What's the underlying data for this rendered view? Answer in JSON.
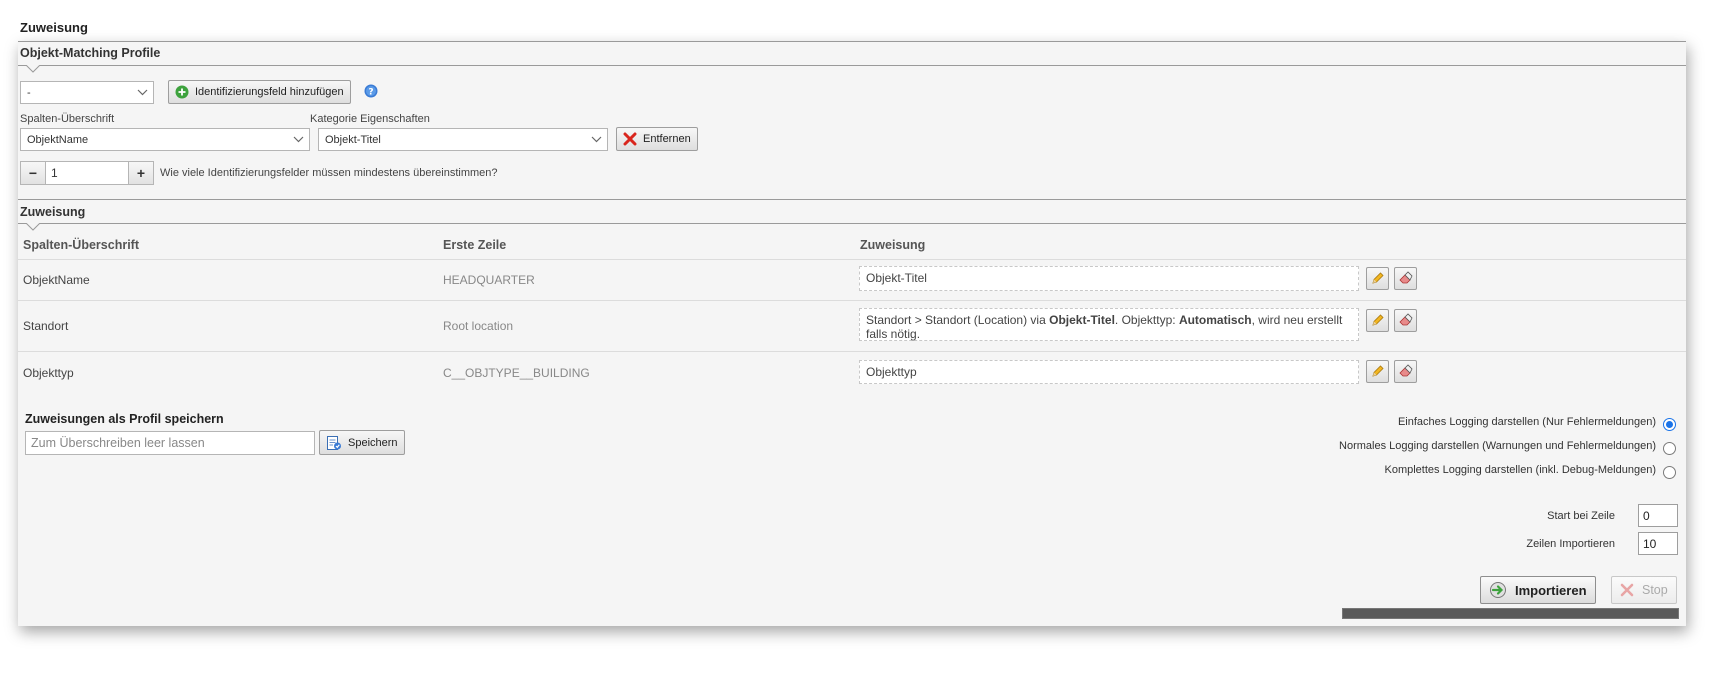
{
  "page": {
    "title": "Zuweisung"
  },
  "matching": {
    "title": "Objekt-Matching Profile",
    "profile_select": "-",
    "add_button": "Identifizierungsfeld hinzufügen",
    "help_icon": "help-icon",
    "col_header_label": "Spalten-Überschrift",
    "category_label": "Kategorie Eigenschaften",
    "col_header_value": "ObjektName",
    "category_value": "Objekt-Titel",
    "remove_button": "Entfernen",
    "min_count": "1",
    "min_count_label": "Wie viele Identifizierungsfelder müssen mindestens übereinstimmen?"
  },
  "assignment": {
    "title": "Zuweisung",
    "headers": {
      "col": "Spalten-Überschrift",
      "first_row": "Erste Zeile",
      "assign": "Zuweisung"
    },
    "rows": [
      {
        "col": "ObjektName",
        "first_row": "HEADQUARTER",
        "assign": "Objekt-Titel"
      },
      {
        "col": "Standort",
        "first_row": "Root location",
        "assign_parts": {
          "a": "Standort > Standort (Location) via ",
          "b": "Objekt-Titel",
          "c": ". Objekttyp: ",
          "d": "Automatisch",
          "e": ", wird neu erstellt falls nötig."
        }
      },
      {
        "col": "Objekttyp",
        "first_row": "C__OBJTYPE__BUILDING",
        "assign": "Objekttyp"
      }
    ]
  },
  "save_profile": {
    "title": "Zuweisungen als Profil speichern",
    "placeholder": "Zum Überschreiben leer lassen",
    "button": "Speichern"
  },
  "logging": {
    "options": [
      {
        "label": "Einfaches Logging darstellen (Nur Fehlermeldungen)",
        "checked": true
      },
      {
        "label": "Normales Logging darstellen (Warnungen und Fehlermeldungen)",
        "checked": false
      },
      {
        "label": "Komplettes Logging darstellen (inkl. Debug-Meldungen)",
        "checked": false
      }
    ]
  },
  "import": {
    "start_label": "Start bei Zeile",
    "start_value": "0",
    "rows_label": "Zeilen Importieren",
    "rows_value": "10",
    "import_button": "Importieren",
    "stop_button": "Stop",
    "progress": 1.0
  },
  "colors": {
    "accent": "#1a73e8",
    "remove_red": "#d9251c",
    "add_green": "#3da23d"
  }
}
